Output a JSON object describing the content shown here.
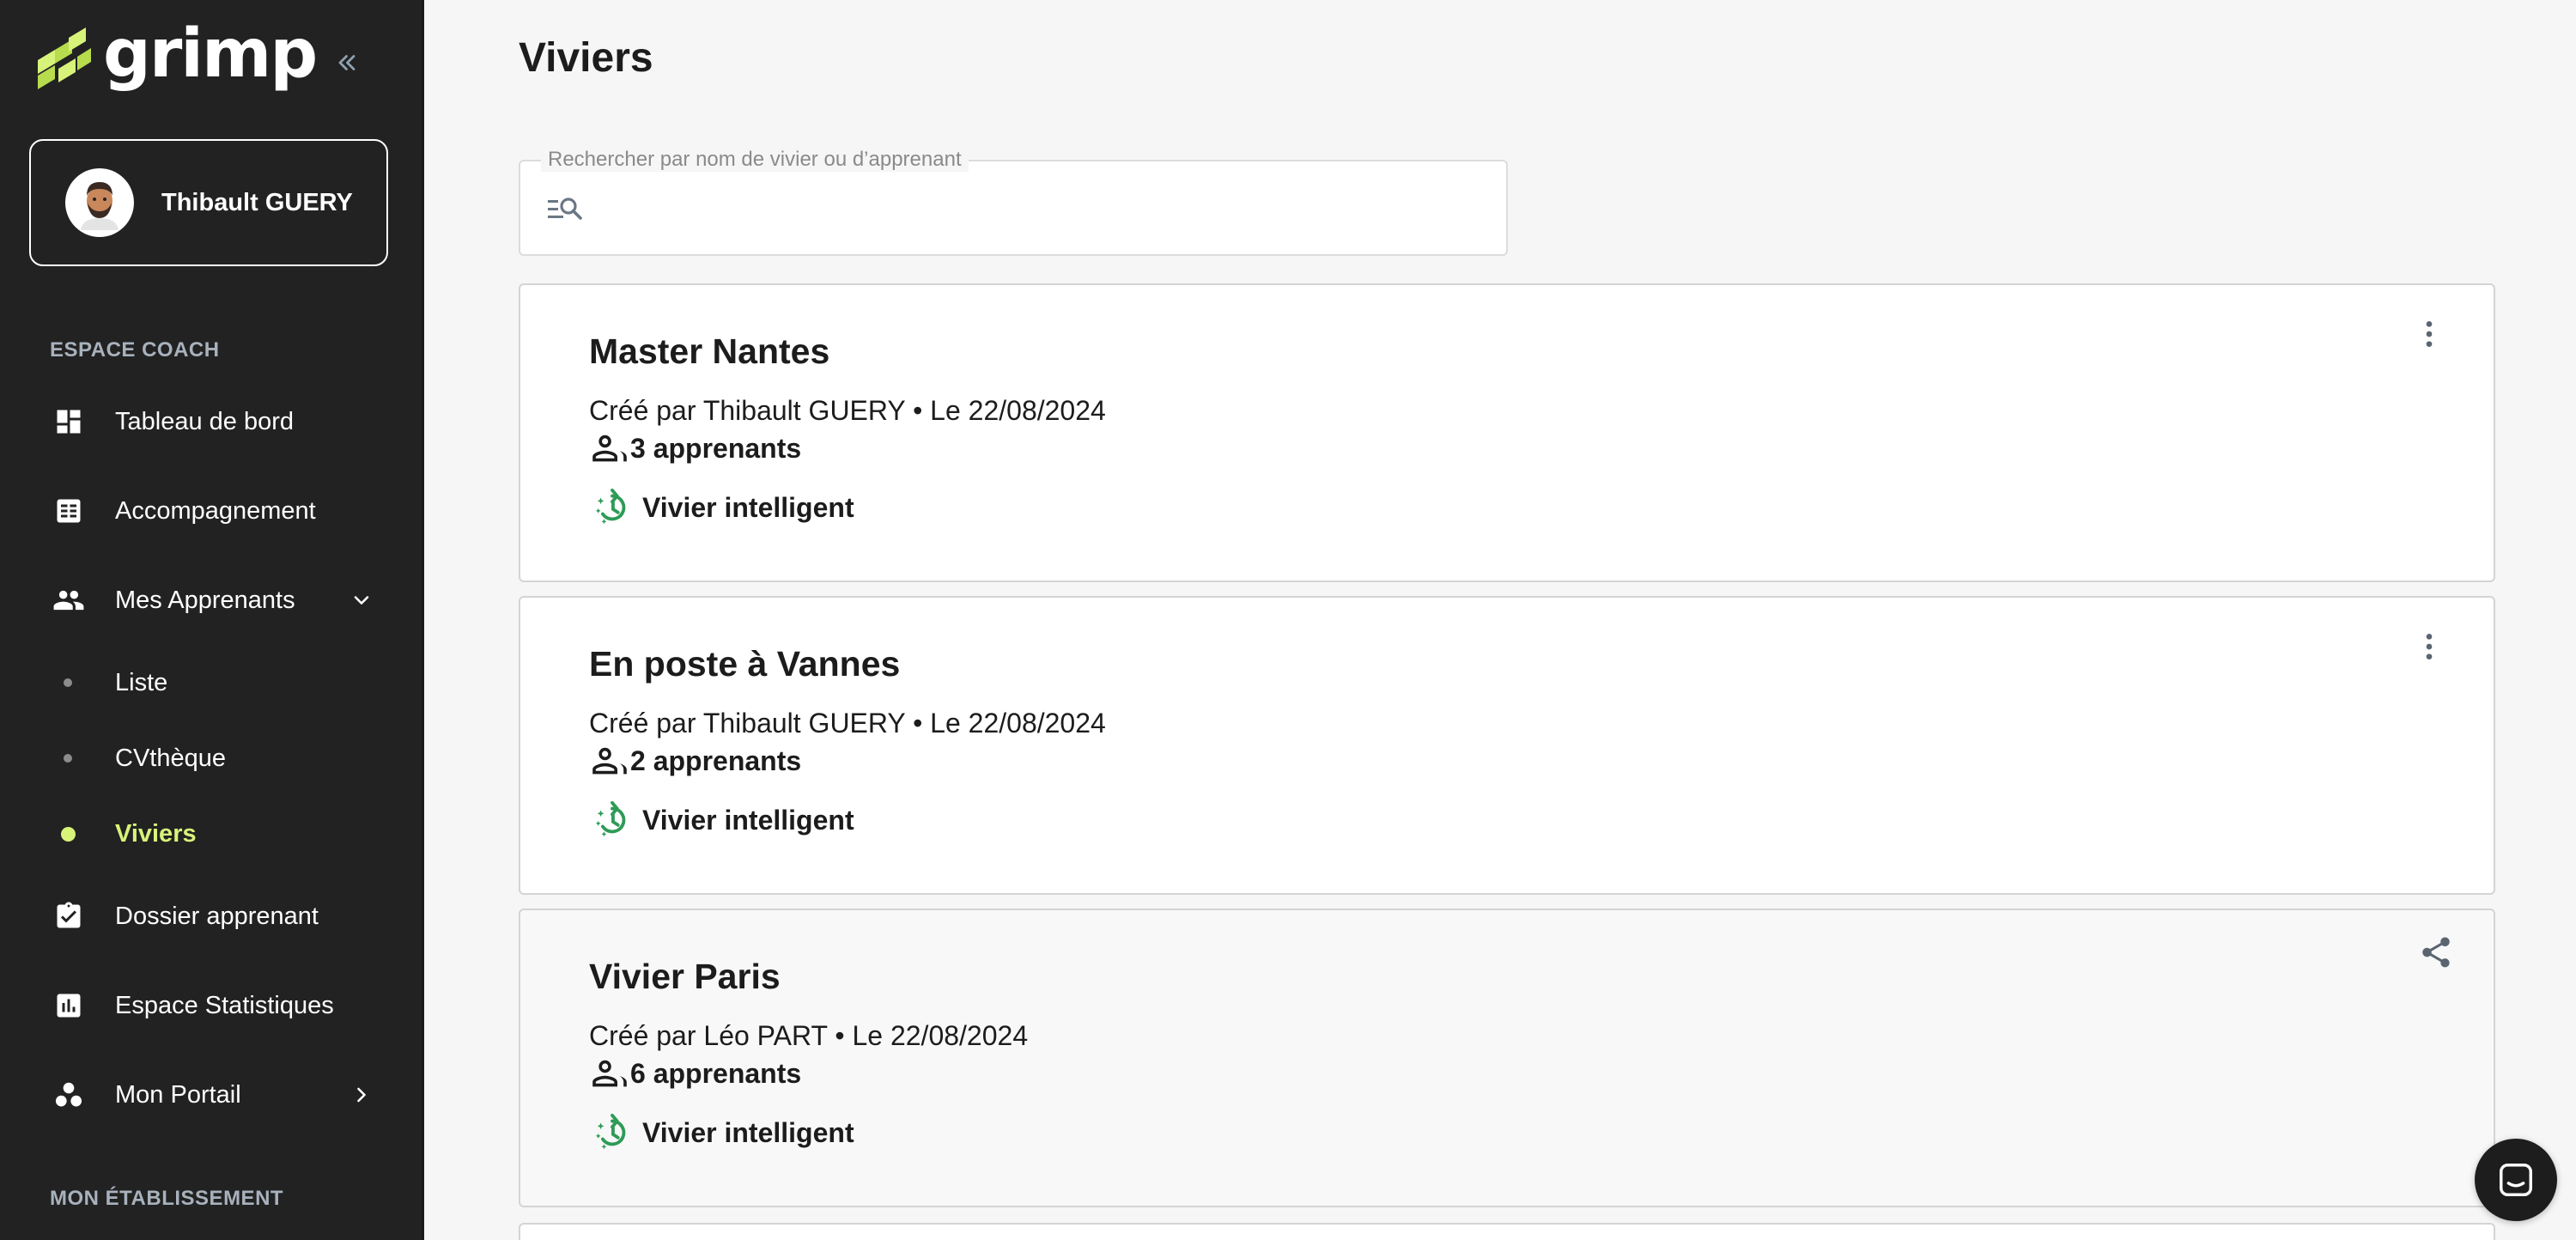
{
  "app": {
    "logo_text": "grimp"
  },
  "user": {
    "name": "Thibault GUERY"
  },
  "sidebar": {
    "section_coach": "ESPACE COACH",
    "section_etablissement": "MON ÉTABLISSEMENT",
    "items": [
      {
        "label": "Tableau de bord",
        "icon": "dashboard-icon"
      },
      {
        "label": "Accompagnement",
        "icon": "list-alt-icon"
      },
      {
        "label": "Mes Apprenants",
        "icon": "people-icon",
        "expanded": true
      },
      {
        "label": "Dossier apprenant",
        "icon": "assignment-check-icon"
      },
      {
        "label": "Espace Statistiques",
        "icon": "stats-icon"
      },
      {
        "label": "Mon Portail",
        "icon": "workspaces-icon"
      }
    ],
    "sub_items": [
      {
        "label": "Liste",
        "active": false
      },
      {
        "label": "CVthèque",
        "active": false
      },
      {
        "label": "Viviers",
        "active": true
      }
    ]
  },
  "main": {
    "title": "Viviers",
    "search": {
      "label": "Rechercher par nom de vivier ou d’apprenant",
      "value": ""
    },
    "cards": [
      {
        "title": "Master Nantes",
        "meta": "Créé par Thibault GUERY • Le 22/08/2024",
        "count": "3 apprenants",
        "tag": "Vivier intelligent",
        "action": "more-vert-icon"
      },
      {
        "title": "En poste à Vannes",
        "meta": "Créé par Thibault GUERY • Le 22/08/2024",
        "count": "2 apprenants",
        "tag": "Vivier intelligent",
        "action": "more-vert-icon"
      },
      {
        "title": "Vivier Paris",
        "meta": "Créé par Léo PART • Le 22/08/2024",
        "count": "6 apprenants",
        "tag": "Vivier intelligent",
        "action": "share-icon"
      }
    ]
  },
  "colors": {
    "sidebar_bg": "#222222",
    "accent": "#d8f37a",
    "smart_icon": "#2e9b57",
    "main_bg": "#f6f6f6"
  }
}
